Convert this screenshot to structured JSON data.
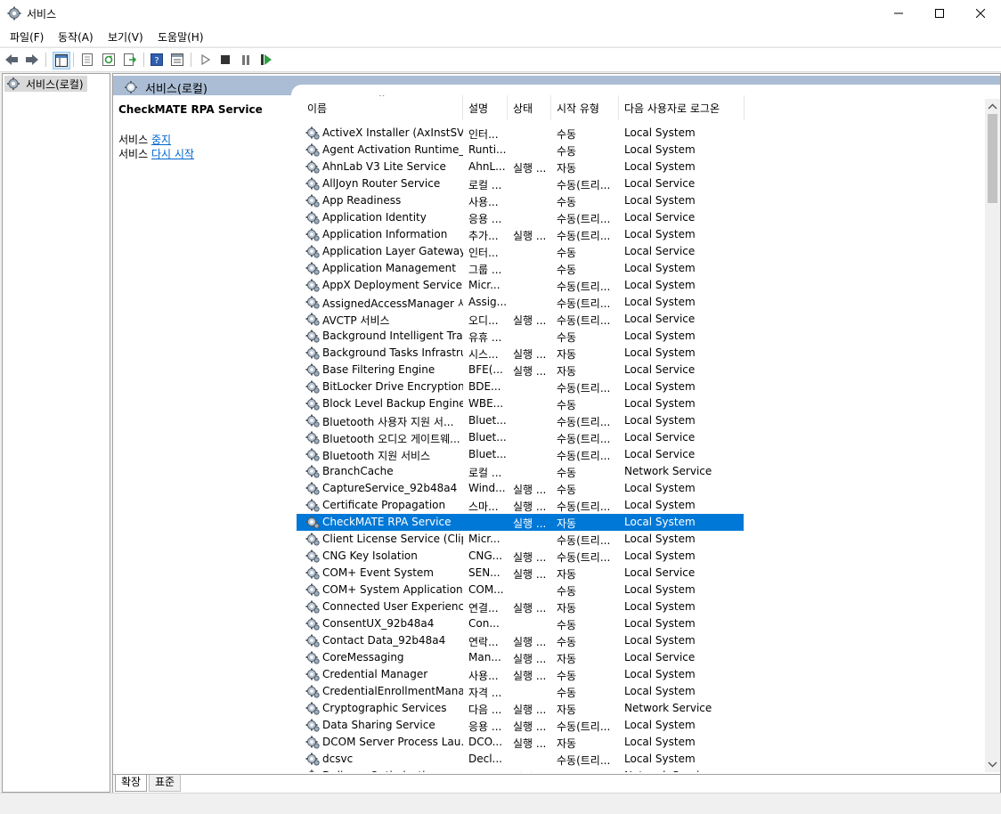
{
  "window": {
    "title": "서비스"
  },
  "menu": {
    "items": [
      "파일(F)",
      "동작(A)",
      "보기(V)",
      "도움말(H)"
    ]
  },
  "tree": {
    "root_label": "서비스(로컬)"
  },
  "content": {
    "header_label": "서비스(로컬)",
    "selected_title": "CheckMATE RPA Service",
    "action1_prefix": "서비스 ",
    "action1_link": "중지",
    "action2_prefix": "서비스 ",
    "action2_link": "다시 시작"
  },
  "table": {
    "columns": [
      "이름",
      "설명",
      "상태",
      "시작 유형",
      "다음 사용자로 로그온"
    ],
    "rows": [
      [
        "ActiveX Installer (AxInstSV)",
        "인터...",
        "",
        "수동",
        "Local System"
      ],
      [
        "Agent Activation Runtime_...",
        "Runti...",
        "",
        "수동",
        "Local System"
      ],
      [
        "AhnLab V3 Lite Service",
        "AhnL...",
        "실행 ...",
        "자동",
        "Local System"
      ],
      [
        "AllJoyn Router Service",
        "로컬 ...",
        "",
        "수동(트리...",
        "Local Service"
      ],
      [
        "App Readiness",
        "사용...",
        "",
        "수동",
        "Local System"
      ],
      [
        "Application Identity",
        "응용 ...",
        "",
        "수동(트리...",
        "Local Service"
      ],
      [
        "Application Information",
        "추가...",
        "실행 ...",
        "수동(트리...",
        "Local System"
      ],
      [
        "Application Layer Gateway ...",
        "인터...",
        "",
        "수동",
        "Local Service"
      ],
      [
        "Application Management",
        "그룹 ...",
        "",
        "수동",
        "Local System"
      ],
      [
        "AppX Deployment Service ...",
        "Micr...",
        "",
        "수동(트리...",
        "Local System"
      ],
      [
        "AssignedAccessManager 서...",
        "Assig...",
        "",
        "수동(트리...",
        "Local System"
      ],
      [
        "AVCTP 서비스",
        "오디...",
        "실행 ...",
        "수동(트리...",
        "Local Service"
      ],
      [
        "Background Intelligent Tra...",
        "유휴 ...",
        "",
        "수동",
        "Local System"
      ],
      [
        "Background Tasks Infrastru...",
        "시스...",
        "실행 ...",
        "자동",
        "Local System"
      ],
      [
        "Base Filtering Engine",
        "BFE(...",
        "실행 ...",
        "자동",
        "Local Service"
      ],
      [
        "BitLocker Drive Encryption ...",
        "BDE...",
        "",
        "수동(트리...",
        "Local System"
      ],
      [
        "Block Level Backup Engine ...",
        "WBE...",
        "",
        "수동",
        "Local System"
      ],
      [
        "Bluetooth 사용자 지원 서...",
        "Bluet...",
        "",
        "수동(트리...",
        "Local System"
      ],
      [
        "Bluetooth 오디오 게이트웨...",
        "Bluet...",
        "",
        "수동(트리...",
        "Local Service"
      ],
      [
        "Bluetooth 지원 서비스",
        "Bluet...",
        "",
        "수동(트리...",
        "Local Service"
      ],
      [
        "BranchCache",
        "로컬 ...",
        "",
        "수동",
        "Network Service"
      ],
      [
        "CaptureService_92b48a4",
        "Wind...",
        "실행 ...",
        "수동",
        "Local System"
      ],
      [
        "Certificate Propagation",
        "스마...",
        "실행 ...",
        "수동(트리...",
        "Local System"
      ],
      [
        "CheckMATE RPA Service",
        "",
        "실행 ...",
        "자동",
        "Local System"
      ],
      [
        "Client License Service (Clip...",
        "Micr...",
        "",
        "수동(트리...",
        "Local System"
      ],
      [
        "CNG Key Isolation",
        "CNG...",
        "실행 ...",
        "수동(트리...",
        "Local System"
      ],
      [
        "COM+ Event System",
        "SEN...",
        "실행 ...",
        "자동",
        "Local Service"
      ],
      [
        "COM+ System Application",
        "COM...",
        "",
        "수동",
        "Local System"
      ],
      [
        "Connected User Experience...",
        "연결...",
        "실행 ...",
        "자동",
        "Local System"
      ],
      [
        "ConsentUX_92b48a4",
        "Con...",
        "",
        "수동",
        "Local System"
      ],
      [
        "Contact Data_92b48a4",
        "연락...",
        "실행 ...",
        "수동",
        "Local System"
      ],
      [
        "CoreMessaging",
        "Man...",
        "실행 ...",
        "자동",
        "Local Service"
      ],
      [
        "Credential Manager",
        "사용...",
        "실행 ...",
        "수동",
        "Local System"
      ],
      [
        "CredentialEnrollmentMana...",
        "자격 ...",
        "",
        "수동",
        "Local System"
      ],
      [
        "Cryptographic Services",
        "다음 ...",
        "실행 ...",
        "자동",
        "Network Service"
      ],
      [
        "Data Sharing Service",
        "응용 ...",
        "실행 ...",
        "수동(트리...",
        "Local System"
      ],
      [
        "DCOM Server Process Lau...",
        "DCO...",
        "실행 ...",
        "자동",
        "Local System"
      ],
      [
        "dcsvc",
        "Decl...",
        "",
        "수동(트리...",
        "Local System"
      ],
      [
        "Delivery Optimization",
        "콘텐...",
        "실행 ...",
        "자동(지연...",
        "Network Service"
      ]
    ],
    "selected_index": 23
  },
  "tabs": {
    "items": [
      "확장",
      "표준"
    ]
  },
  "icons": {
    "app": "gear-icon",
    "service": "service-gear-icon",
    "back": "back-arrow-icon",
    "forward": "forward-arrow-icon",
    "console_tree": "console-tree-icon",
    "properties": "properties-icon",
    "refresh": "refresh-icon",
    "export": "export-list-icon",
    "help": "help-icon",
    "show_hide": "show-hide-icon",
    "start": "play-icon",
    "stop": "stop-icon",
    "pause": "pause-icon",
    "restart": "restart-icon"
  },
  "colors": {
    "selection": "#0078d7",
    "header_band": "#aabdd4",
    "link": "#0066cc"
  }
}
